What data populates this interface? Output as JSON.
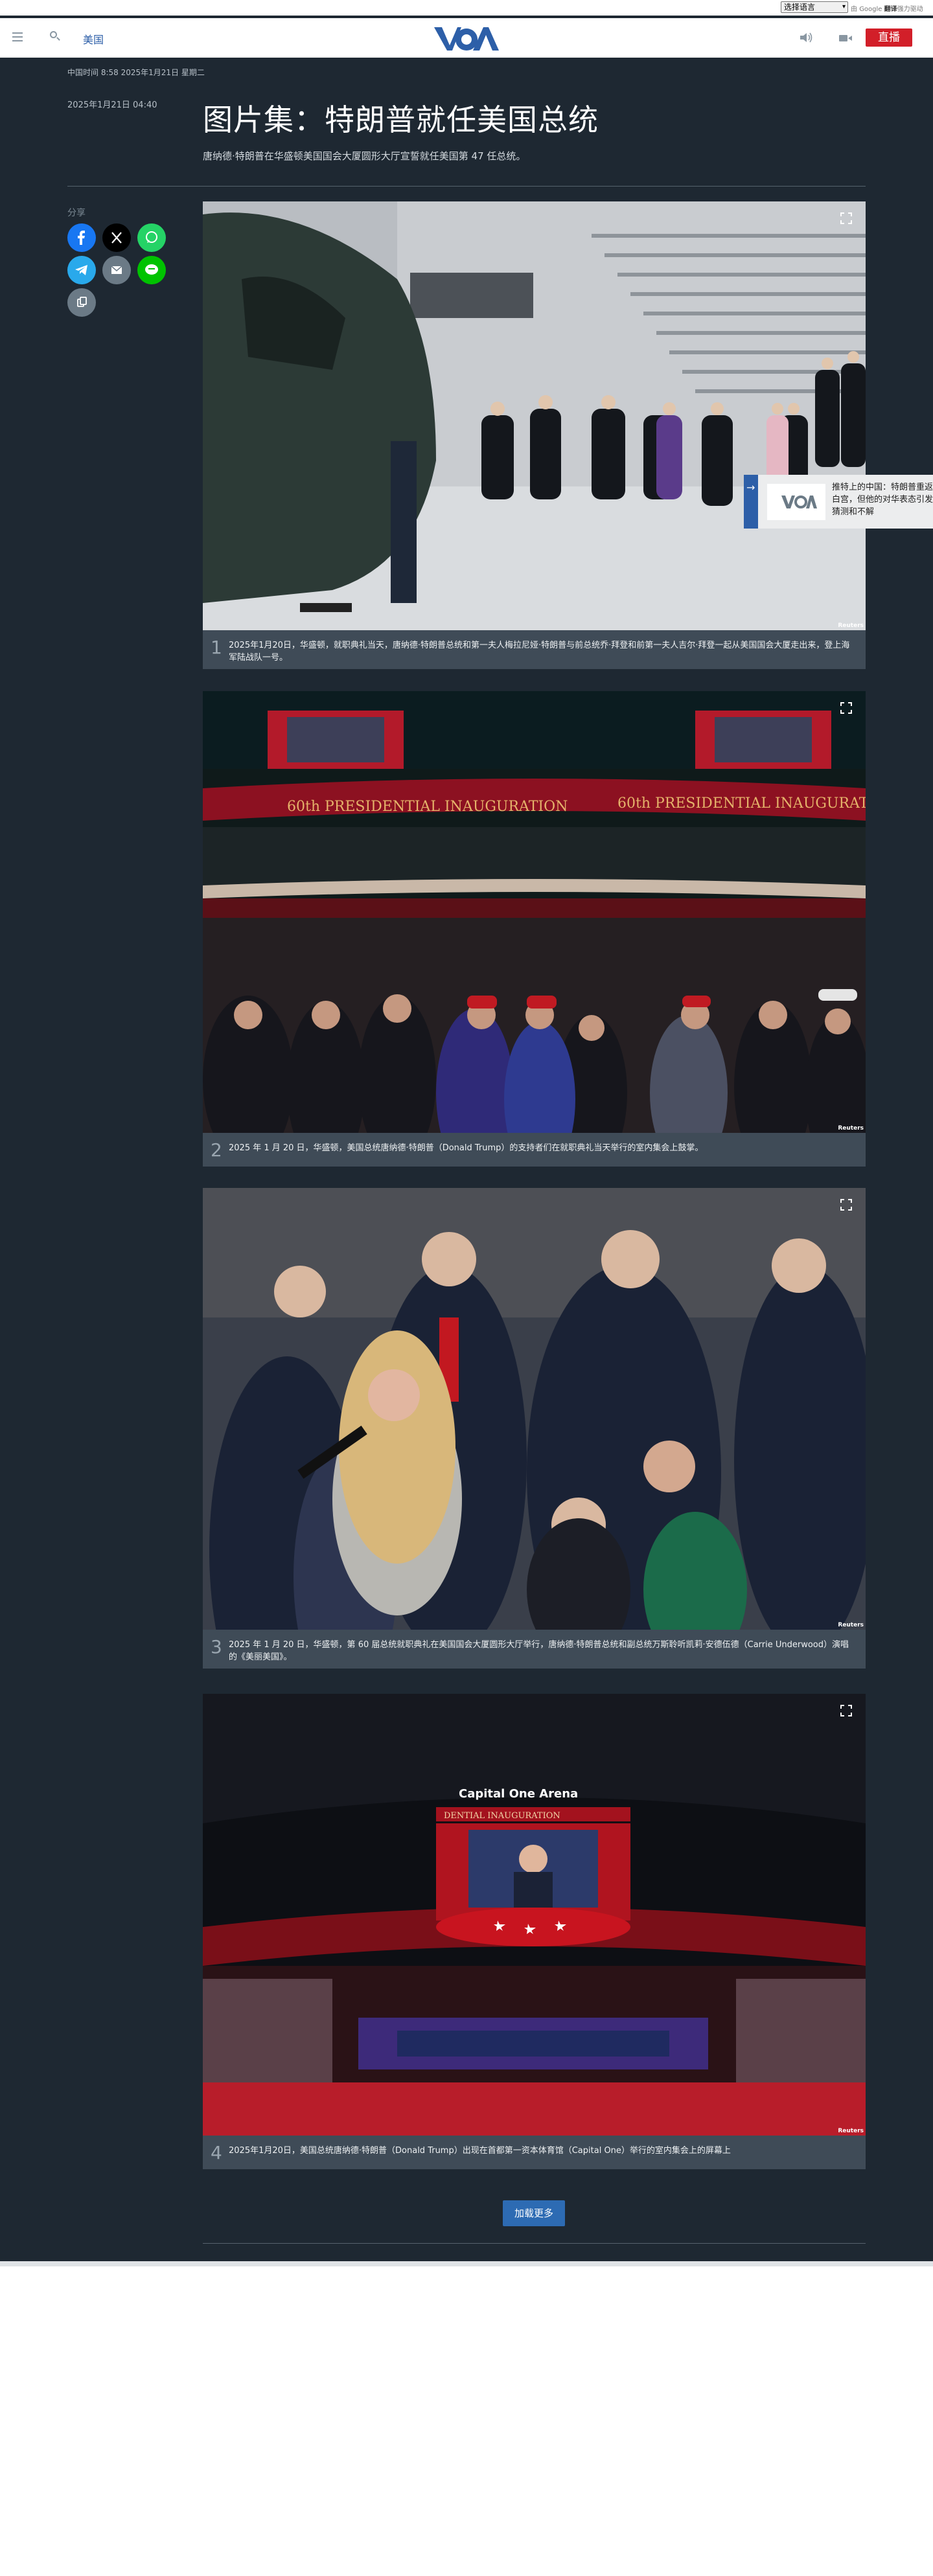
{
  "translate": {
    "select_label": "选择语言",
    "powered_prefix": "由",
    "powered_brand": "Google",
    "powered_word": "翻译",
    "powered_suffix": "强力驱动"
  },
  "header": {
    "section": "美国",
    "logo": "VOA",
    "live": "直播"
  },
  "article": {
    "meta": "中国时间 8:58 2025年1月21日 星期二",
    "date": "2025年1月21日 04:40",
    "title": "图片集：特朗普就任美国总统",
    "subtitle": "唐纳德·特朗普在华盛顿美国国会大厦圆形大厅宣誓就任美国第 47 任总统。"
  },
  "share": {
    "label": "分享",
    "buttons": [
      {
        "name": "facebook",
        "color": "#1877f2"
      },
      {
        "name": "x",
        "color": "#000000"
      },
      {
        "name": "whatsapp",
        "color": "#25d366"
      },
      {
        "name": "telegram",
        "color": "#29a9eb"
      },
      {
        "name": "email",
        "color": "#6b7a86"
      },
      {
        "name": "line",
        "color": "#00c300"
      },
      {
        "name": "copy-link",
        "color": "#6b7a86"
      }
    ]
  },
  "slides": [
    {
      "num": "1",
      "credit": "Reuters",
      "caption": "2025年1月20日，华盛顿，就职典礼当天，唐纳德·特朗普总统和第一夫人梅拉尼娅·特朗普与前总统乔·拜登和前第一夫人吉尔·拜登一起从美国国会大厦走出来，登上海军陆战队一号。"
    },
    {
      "num": "2",
      "credit": "Reuters",
      "caption": "2025 年 1 月 20 日，华盛顿，美国总统唐纳德·特朗普（Donald Trump）的支持者们在就职典礼当天举行的室内集会上鼓掌。"
    },
    {
      "num": "3",
      "credit": "Reuters",
      "caption": "2025 年 1 月 20 日，华盛顿，第 60 届总统就职典礼在美国国会大厦圆形大厅举行，唐纳德·特朗普总统和副总统万斯聆听凯莉·安德伍德（Carrie Underwood）演唱的《美丽美国》。"
    },
    {
      "num": "4",
      "credit": "Reuters",
      "caption": "2025年1月20日，美国总统唐纳德·特朗普（Donald Trump）出现在首都第一资本体育馆（Capital One）举行的室内集会上的屏幕上"
    }
  ],
  "arena": {
    "sign": "Capital One Arena",
    "banner": "60th PRESIDENTIAL INAUGURATION",
    "banner2": "DENTIAL INAUGURATION"
  },
  "recommend": {
    "text": "推特上的中国：特朗普重返白宫，但他的对华表态引发猜测和不解"
  },
  "load_more": "加载更多"
}
